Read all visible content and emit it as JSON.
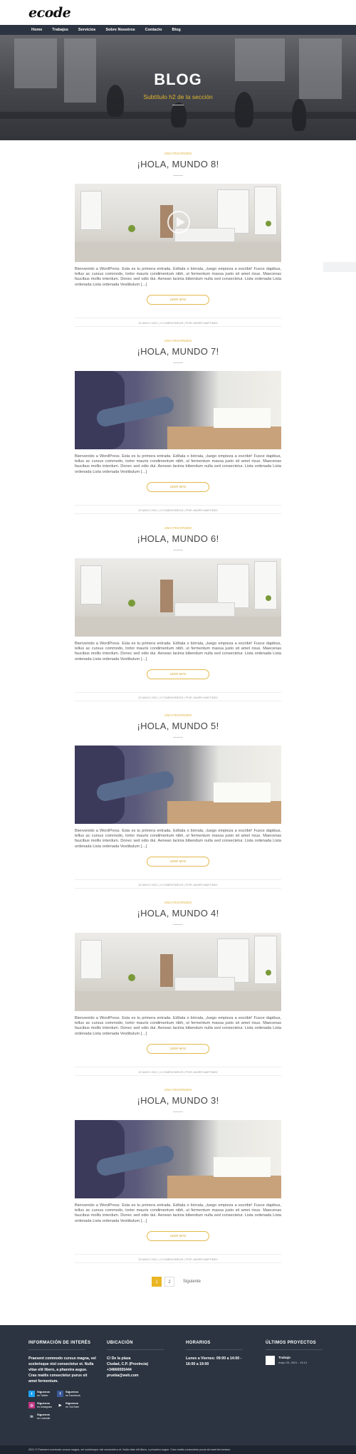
{
  "header": {
    "logo": "ecode"
  },
  "nav": [
    "Home",
    "Trabajos",
    "Servicios",
    "Sobre Nosotros",
    "Contacto",
    "Blog"
  ],
  "hero": {
    "title": "BLOG",
    "subtitle": "Subtítulo h2 de la sección"
  },
  "posts": [
    {
      "category": "UNCATEGORIZED",
      "title": "¡HOLA, MUNDO 8!",
      "image": "room",
      "play": true
    },
    {
      "category": "UNCATEGORIZED",
      "title": "¡HOLA, MUNDO 7!",
      "image": "couch",
      "play": false
    },
    {
      "category": "UNCATEGORIZED",
      "title": "¡HOLA, MUNDO 6!",
      "image": "room",
      "play": false
    },
    {
      "category": "UNCATEGORIZED",
      "title": "¡HOLA, MUNDO 5!",
      "image": "couch",
      "play": false
    },
    {
      "category": "UNCATEGORIZED",
      "title": "¡HOLA, MUNDO 4!",
      "image": "room",
      "play": false
    },
    {
      "category": "UNCATEGORIZED",
      "title": "¡HOLA, MUNDO 3!",
      "image": "couch",
      "play": false
    }
  ],
  "post_excerpt": "Bienvenido a WordPress. Esta es tu primera entrada. Edítala o bórrala, ¡luego empieza a escribir! Fusce dapibus, tellus ac cursus commodo, tortor mauris condimentum nibh, ut fermentum massa justo sit amet risus. Maecenas faucibus mollis interdum. Donec sed odio dui. Aenean lacinia bibendum nulla sed consectetur.   Lista ordenada Lista ordenada Lista ordenada   Vestibulum […]",
  "read_more": "LEER MÁS",
  "post_meta": "20 MAYO 2021 | 0 COMENTARIOS | POR JAVIER MARTINEZ",
  "pagination": {
    "pages": [
      "1",
      "2"
    ],
    "next": "Siguiente"
  },
  "footer": {
    "info_title": "INFORMACIÓN DE INTERÉS",
    "info_text": "Praesent commodo cursus magna, vel scelerisque nisl consectetur et. Nulla vitae elit libero, a pharetra augue. Cras mattis consectetur purus sit amet fermentum.",
    "location_title": "UBICACIÓN",
    "location_lines": [
      "C/ De la plaza",
      "Ciudad, C.P. (Provincia)",
      "+34666555444",
      "prueba@web.com"
    ],
    "hours_title": "HORARIOS",
    "hours_text": "Lunes a Viernes: 09:00 a 14:00 - 16:00 a 19:00",
    "projects_title": "ÚLTIMOS PROYECTOS",
    "project": {
      "name": "Trabajo",
      "date": "mayo 25, 2021 - 13:14"
    },
    "social": [
      {
        "name": "Síguenos",
        "net": "en Twitter",
        "icon": "twitter-icon",
        "color": "#1da1f2",
        "glyph": "t"
      },
      {
        "name": "Síguenos",
        "net": "en Facebook",
        "icon": "facebook-icon",
        "color": "#3b5998",
        "glyph": "f"
      },
      {
        "name": "Síguenos",
        "net": "en Instagram",
        "icon": "instagram-icon",
        "color": "#c13584",
        "glyph": "◎"
      },
      {
        "name": "Síguenos",
        "net": "en YouTube",
        "icon": "youtube-icon",
        "color": "#2b3440",
        "glyph": "▶"
      },
      {
        "name": "Síguenos",
        "net": "en Linkedin",
        "icon": "linkedin-icon",
        "color": "#2b3440",
        "glyph": "in"
      }
    ]
  },
  "copyright": "2021 © Praesent commodo cursus magna, vel scelerisque nisl consectetur et. Nulla vitae elit libero, a pharetra augue. Cras mattis consectetur purus sit amet fermentum."
}
